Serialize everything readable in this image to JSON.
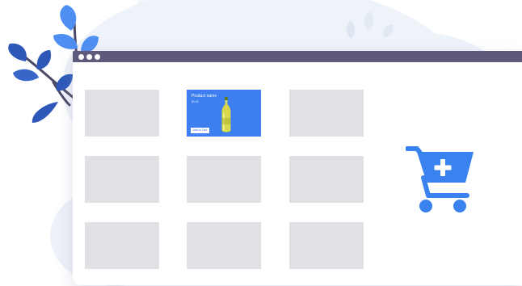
{
  "window": {
    "controls": [
      "dot",
      "dot",
      "dot"
    ]
  },
  "grid": {
    "rows": 3,
    "columns": 3,
    "tiles": [
      {
        "state": "placeholder"
      },
      {
        "state": "featured"
      },
      {
        "state": "placeholder"
      },
      {
        "state": "placeholder"
      },
      {
        "state": "placeholder"
      },
      {
        "state": "placeholder"
      },
      {
        "state": "placeholder"
      },
      {
        "state": "placeholder"
      },
      {
        "state": "placeholder"
      }
    ]
  },
  "featured_product": {
    "name": "Product name",
    "price": "$0.00",
    "button_label": "Add to Cart",
    "image_icon": "oil-bottle-icon"
  },
  "cart_icon": "add-to-cart-icon",
  "decorations": [
    "leaf-branch",
    "background-blobs",
    "ghost-leaves"
  ],
  "colors": {
    "titlebar": "#5d5a7b",
    "accent": "#3d7ff0",
    "cart": "#3a82f0",
    "placeholder_tile": "#e1e0e5",
    "leaf_dark": "#2d58b8",
    "leaf_light": "#4f8ef2",
    "stem": "#4a4a68"
  }
}
